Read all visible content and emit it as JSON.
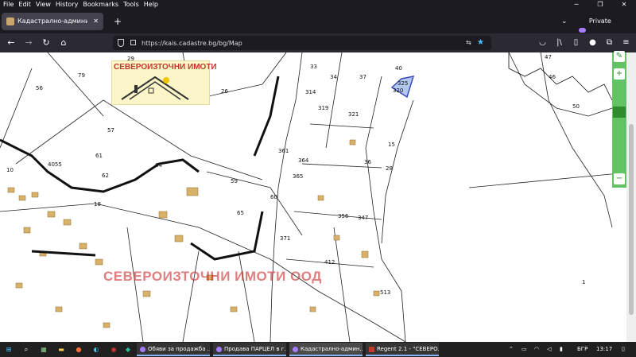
{
  "menubar": {
    "items": [
      "File",
      "Edit",
      "View",
      "History",
      "Bookmarks",
      "Tools",
      "Help"
    ]
  },
  "window_controls": [
    "─",
    "❐",
    "✕"
  ],
  "tabs": [
    {
      "title": "Кадастрално-административ",
      "close": "✕"
    }
  ],
  "new_tab": "+",
  "tab_list": "⌄",
  "private_label": "Private browsing",
  "nav": {
    "back": "←",
    "forward": "→",
    "reload": "↻",
    "home": "⌂"
  },
  "url": {
    "value": "https://kais.cadastre.bg/bg/Map"
  },
  "toolbar_icons": [
    "pocket-icon",
    "library-icon",
    "sidebar-icon",
    "account-icon",
    "extensions-icon",
    "menu-icon"
  ],
  "map": {
    "ad_title": "СЕВЕРОИЗТОЧНИ ИМОТИ",
    "watermark": "СЕВЕРОИЗТОЧНИ ИМОТИ ООД",
    "labels": [
      "29",
      "79",
      "56",
      "26",
      "57",
      "61",
      "4055",
      "64",
      "62",
      "59",
      "65",
      "60",
      "33",
      "34",
      "37",
      "40",
      "47",
      "46",
      "50",
      "325",
      "320",
      "314",
      "319",
      "321",
      "361",
      "364",
      "365",
      "371",
      "356",
      "347",
      "412",
      "513",
      "1",
      "10",
      "15",
      "18",
      "28",
      "36"
    ]
  },
  "zoom": {
    "plus": "+",
    "minus": "−",
    "edit": "✎"
  },
  "taskbar": {
    "windows": [
      "Обяви за продажба ...",
      "Продава ПАРЦЕЛ в г...",
      "Кадастрално-админ...",
      "Regent 2.1 - \"СЕВЕРО..."
    ],
    "lang": "БГР",
    "time": "13:17"
  }
}
